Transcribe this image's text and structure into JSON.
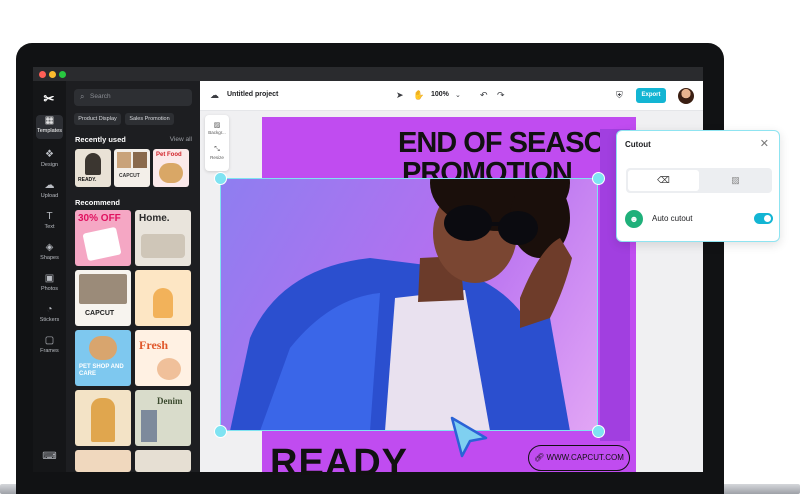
{
  "sidebar": {
    "items": [
      {
        "label": "Templates",
        "icon": "templates-icon"
      },
      {
        "label": "Design",
        "icon": "design-icon"
      },
      {
        "label": "Upload",
        "icon": "upload-icon"
      },
      {
        "label": "Text",
        "icon": "text-icon"
      },
      {
        "label": "Shapes",
        "icon": "shapes-icon"
      },
      {
        "label": "Photos",
        "icon": "photos-icon"
      },
      {
        "label": "Stickers",
        "icon": "stickers-icon"
      },
      {
        "label": "Frames",
        "icon": "frames-icon"
      }
    ]
  },
  "panel": {
    "search_placeholder": "Search",
    "chips": [
      "Product Display",
      "Sales Promotion"
    ],
    "recently_used": "Recently used",
    "view_all": "View all",
    "recommend": "Recommend",
    "thumb_text": {
      "ready": "READY.",
      "capcut": "CAPCUT",
      "pet_food": "Pet Food",
      "sale": "30% OFF",
      "home": "Home.",
      "capcut2": "CAPCUT",
      "pet_shop": "PET SHOP AND CARE",
      "fresh": "Fresh",
      "denim": "Denim"
    }
  },
  "toolbar": {
    "project_title": "Untitled project",
    "zoom": "100%",
    "export_label": "Export"
  },
  "side_tools": {
    "background": "Backgr...",
    "resize": "Resize"
  },
  "design": {
    "headline_line1": "END OF SEASON",
    "headline_line2": "PROMOTION",
    "ready": "READY",
    "url": "WWW.CAPCUT.COM"
  },
  "cutout": {
    "title": "Cutout",
    "auto_label": "Auto cutout",
    "auto_enabled": true
  },
  "colors": {
    "accent": "#13b5d3",
    "design_bg": "#c04cf0",
    "selection": "#7fe3f2"
  }
}
